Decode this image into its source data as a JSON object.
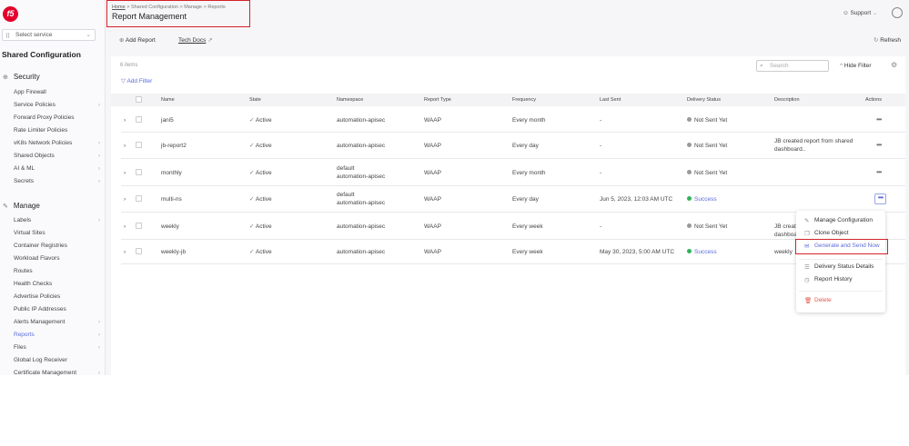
{
  "sidebar": {
    "select_placeholder": "Select service",
    "title": "Shared Configuration",
    "sections": [
      {
        "label": "Security",
        "items": [
          {
            "label": "App Firewall",
            "chevron": false
          },
          {
            "label": "Service Policies",
            "chevron": true
          },
          {
            "label": "Forward Proxy Policies",
            "chevron": false
          },
          {
            "label": "Rate Limiter Policies",
            "chevron": false
          },
          {
            "label": "vK8s Network Policies",
            "chevron": true
          },
          {
            "label": "Shared Objects",
            "chevron": true
          },
          {
            "label": "AI & ML",
            "chevron": true
          },
          {
            "label": "Secrets",
            "chevron": true
          }
        ]
      },
      {
        "label": "Manage",
        "items": [
          {
            "label": "Labels",
            "chevron": true
          },
          {
            "label": "Virtual Sites",
            "chevron": false
          },
          {
            "label": "Container Registries",
            "chevron": false
          },
          {
            "label": "Workload Flavors",
            "chevron": false
          },
          {
            "label": "Routes",
            "chevron": false
          },
          {
            "label": "Health Checks",
            "chevron": false
          },
          {
            "label": "Advertise Policies",
            "chevron": false
          },
          {
            "label": "Public IP Addresses",
            "chevron": false
          },
          {
            "label": "Alerts Management",
            "chevron": true
          },
          {
            "label": "Reports",
            "chevron": true,
            "active": true
          },
          {
            "label": "Files",
            "chevron": true
          },
          {
            "label": "Global Log Receiver",
            "chevron": false
          },
          {
            "label": "Certificate Management",
            "chevron": true
          }
        ]
      }
    ]
  },
  "header": {
    "breadcrumb": [
      "Home",
      "Shared Configuration",
      "Manage",
      "Reports"
    ],
    "title": "Report Management",
    "support": "Support"
  },
  "toolbar": {
    "add_report": "Add Report",
    "tech_docs": "Tech Docs",
    "refresh": "Refresh"
  },
  "list": {
    "count": "6 items",
    "add_filter": "Add Filter",
    "search_placeholder": "Search",
    "hide_filter": "Hide Filter",
    "columns": [
      "Name",
      "State",
      "Namespace",
      "Report Type",
      "Frequency",
      "Last Sent",
      "Delivery Status",
      "Description",
      "Actions"
    ],
    "rows": [
      {
        "name": "jani5",
        "state": "Active",
        "namespace": [
          "automation-apisec"
        ],
        "type": "WAAP",
        "frequency": "Every month",
        "last_sent": "-",
        "delivery": "Not Sent Yet",
        "description": ""
      },
      {
        "name": "jb-report2",
        "state": "Active",
        "namespace": [
          "automation-apisec"
        ],
        "type": "WAAP",
        "frequency": "Every day",
        "last_sent": "-",
        "delivery": "Not Sent Yet",
        "description": "JB created report from shared dashboard.."
      },
      {
        "name": "monthly",
        "state": "Active",
        "namespace": [
          "default",
          "automation-apisec"
        ],
        "type": "WAAP",
        "frequency": "Every month",
        "last_sent": "-",
        "delivery": "Not Sent Yet",
        "description": ""
      },
      {
        "name": "multi-ns",
        "state": "Active",
        "namespace": [
          "default",
          "automation-apisec"
        ],
        "type": "WAAP",
        "frequency": "Every day",
        "last_sent": "Jun 5, 2023, 12:03 AM UTC",
        "delivery": "Success",
        "description": ""
      },
      {
        "name": "weekly",
        "state": "Active",
        "namespace": [
          "automation-apisec"
        ],
        "type": "WAAP",
        "frequency": "Every week",
        "last_sent": "-",
        "delivery": "Not Sent Yet",
        "description": "JB creat dashboa"
      },
      {
        "name": "weekly-jb",
        "state": "Active",
        "namespace": [
          "automation-apisec"
        ],
        "type": "WAAP",
        "frequency": "Every week",
        "last_sent": "May 30, 2023, 5:00 AM UTC",
        "delivery": "Success",
        "description": "weekly"
      }
    ]
  },
  "actions_menu": [
    {
      "label": "Manage Configuration",
      "icon": "pencil-icon"
    },
    {
      "label": "Clone Object",
      "icon": "clone-icon"
    },
    {
      "label": "Generate and Send Now",
      "icon": "mail-icon",
      "highlighted": true
    },
    {
      "label": "Delivery Status Details",
      "icon": "list-icon"
    },
    {
      "label": "Report History",
      "icon": "clock-icon"
    },
    {
      "label": "Delete",
      "icon": "trash-icon",
      "danger": true
    }
  ],
  "colors": {
    "accent": "#5a6bd8",
    "highlight": "#d2232a",
    "success": "#2fb45a",
    "neutral": "#999999",
    "danger": "#e05a4f"
  }
}
